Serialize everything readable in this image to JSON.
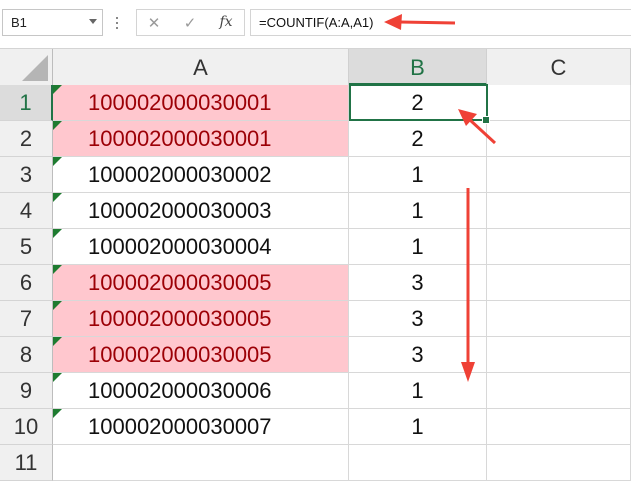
{
  "formula_bar": {
    "name_box": "B1",
    "cancel_icon": "✕",
    "enter_icon": "✓",
    "fx_label": "fx",
    "formula": "=COUNTIF(A:A,A1)"
  },
  "columns": [
    "A",
    "B",
    "C"
  ],
  "active_column": "B",
  "active_cell": "B1",
  "rows": [
    {
      "row": "1",
      "a": "100002000030001",
      "b": "2",
      "dup": true
    },
    {
      "row": "2",
      "a": "100002000030001",
      "b": "2",
      "dup": true
    },
    {
      "row": "3",
      "a": "100002000030002",
      "b": "1",
      "dup": false
    },
    {
      "row": "4",
      "a": "100002000030003",
      "b": "1",
      "dup": false
    },
    {
      "row": "5",
      "a": "100002000030004",
      "b": "1",
      "dup": false
    },
    {
      "row": "6",
      "a": "100002000030005",
      "b": "3",
      "dup": true
    },
    {
      "row": "7",
      "a": "100002000030005",
      "b": "3",
      "dup": true
    },
    {
      "row": "8",
      "a": "100002000030005",
      "b": "3",
      "dup": true
    },
    {
      "row": "9",
      "a": "100002000030006",
      "b": "1",
      "dup": false
    },
    {
      "row": "10",
      "a": "100002000030007",
      "b": "1",
      "dup": false
    },
    {
      "row": "11",
      "a": "",
      "b": "",
      "dup": false
    }
  ],
  "colors": {
    "duplicate_fill": "#ffc7ce",
    "duplicate_text": "#9c0006",
    "selection": "#217346",
    "annotation_arrow": "#ef4136",
    "text_marker": "#1e7b30"
  }
}
